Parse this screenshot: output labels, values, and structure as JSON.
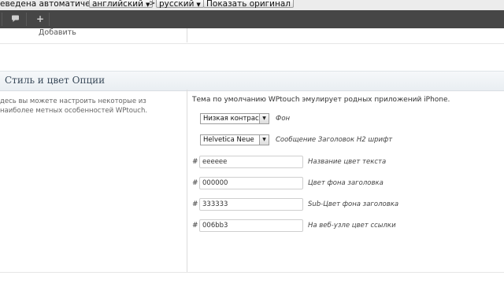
{
  "translate_bar": {
    "prefix_text": "еведена автоматически",
    "from_lang": "английский",
    "separator": ">",
    "to_lang": "русский",
    "show_original": "Показать оригинал"
  },
  "admin_bar": {
    "comments_icon": "speech-bubble-icon",
    "new_icon": "plus-icon",
    "new_symbol": "+",
    "submenu_item": "Добавить"
  },
  "section": {
    "title": "Стиль и цвет Опции",
    "description": "десь вы можете настроить некоторые из наиболее метных особенностей WPtouch.",
    "intro": "Тема по умолчанию WPtouch эмулирует родных приложений iPhone."
  },
  "settings": {
    "background_select": {
      "value": "Низкая контраст",
      "label": "Фон"
    },
    "font_select": {
      "value": "Helvetica Neue",
      "label": "Сообщение Заголовок H2 шрифт"
    },
    "color_fields": [
      {
        "hash": "#",
        "value": "eeeeee",
        "label": "Название цвет текста"
      },
      {
        "hash": "#",
        "value": "000000",
        "label": "Цвет фона заголовка"
      },
      {
        "hash": "#",
        "value": "333333",
        "label": "Sub-Цвет фона заголовка"
      },
      {
        "hash": "#",
        "value": "006bb3",
        "label": "На веб-узле цвет ссылки"
      }
    ]
  }
}
